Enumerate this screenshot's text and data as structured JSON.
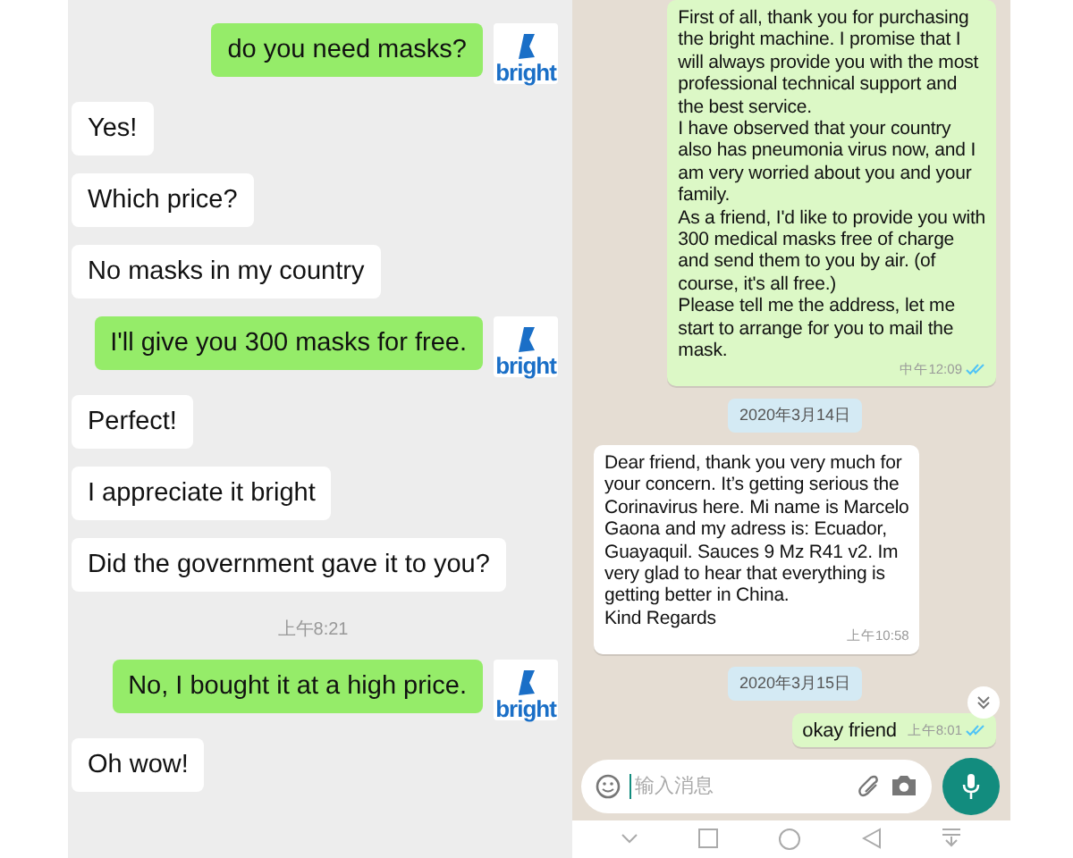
{
  "wechat": {
    "items": [
      {
        "kind": "sent",
        "text": "do you need masks?",
        "avatar_text": "bright"
      },
      {
        "kind": "received",
        "text": "Yes!"
      },
      {
        "kind": "received",
        "text": "Which price?"
      },
      {
        "kind": "received",
        "text": "No masks in my country"
      },
      {
        "kind": "sent",
        "text": "I'll give you 300 masks for free.",
        "avatar_text": "bright"
      },
      {
        "kind": "received",
        "text": "Perfect!"
      },
      {
        "kind": "received",
        "text": "I appreciate it bright"
      },
      {
        "kind": "received",
        "text": "Did the government gave it to you?"
      },
      {
        "kind": "time",
        "text": "上午8:21"
      },
      {
        "kind": "sent",
        "text": "No, I bought it at a high price.",
        "avatar_text": "bright"
      },
      {
        "kind": "received",
        "text": "Oh wow!"
      }
    ]
  },
  "whatsapp": {
    "items": [
      {
        "kind": "sent",
        "text": "First of all, thank you for purchasing\nthe bright machine. I promise that I\nwill always provide you with the most\nprofessional technical support and\nthe best service.\nI have observed that your country\nalso has pneumonia virus now, and I\nam very worried about you and your\nfamily.\nAs a friend, I'd like to provide you with\n300 medical masks free of charge\nand send them to you by air. (of\ncourse, it's all free.)\nPlease tell me the address, let me\nstart to arrange for you to mail the\nmask.",
        "time": "中午12:09",
        "read": true
      },
      {
        "kind": "date",
        "text": "2020年3月14日"
      },
      {
        "kind": "received",
        "text": "Dear friend, thank you very much for\nyour concern. It’s getting serious the\nCorinavirus here. Mi name is Marcelo\nGaona and my adress is: Ecuador,\nGuayaquil. Sauces 9 Mz R41 v2. Im\nvery glad to hear that everything is\ngetting better in China.\nKind Regards",
        "time": "上午10:58"
      },
      {
        "kind": "date",
        "text": "2020年3月15日"
      },
      {
        "kind": "sent",
        "text": "okay friend",
        "time": "上午8:01",
        "read": true
      }
    ],
    "input": {
      "placeholder": "输入消息"
    }
  }
}
